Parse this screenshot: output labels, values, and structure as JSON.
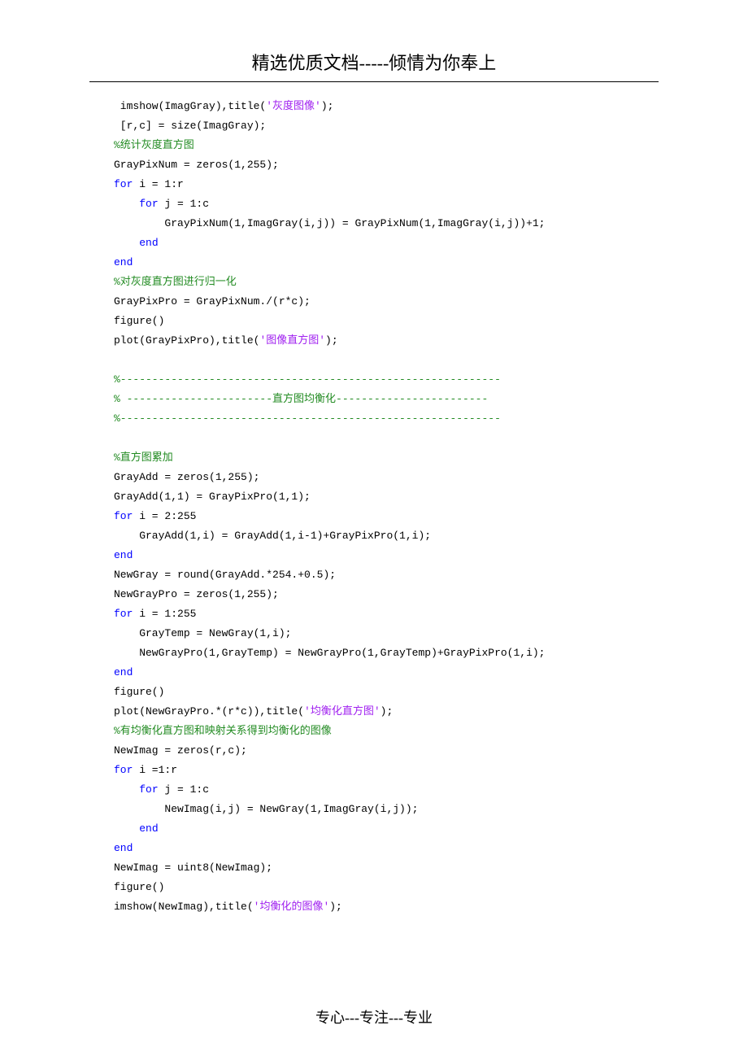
{
  "header": "精选优质文档-----倾情为你奉上",
  "footer": "专心---专注---专业",
  "lines": [
    [
      [
        " imshow(ImagGray),title("
      ],
      [
        "'灰度图像'",
        "purple"
      ],
      [
        ");"
      ]
    ],
    [
      [
        " [r,c] = size(ImagGray);"
      ]
    ],
    [
      [
        "%统计灰度直方图",
        "green"
      ]
    ],
    [
      [
        "GrayPixNum = zeros(1,255);"
      ]
    ],
    [
      [
        "for",
        "blue"
      ],
      [
        " i = 1:r"
      ]
    ],
    [
      [
        "    "
      ],
      [
        "for",
        "blue"
      ],
      [
        " j = 1:c"
      ]
    ],
    [
      [
        "        GrayPixNum(1,ImagGray(i,j)) = GrayPixNum(1,ImagGray(i,j))+1;"
      ]
    ],
    [
      [
        "    "
      ],
      [
        "end",
        "blue"
      ]
    ],
    [
      [
        "end",
        "blue"
      ]
    ],
    [
      [
        "%对灰度直方图进行归一化",
        "green"
      ]
    ],
    [
      [
        "GrayPixPro = GrayPixNum./(r*c);"
      ]
    ],
    [
      [
        "figure()"
      ]
    ],
    [
      [
        "plot(GrayPixPro),title("
      ],
      [
        "'图像直方图'",
        "purple"
      ],
      [
        ");"
      ]
    ],
    [
      [
        " "
      ]
    ],
    [
      [
        "%------------------------------------------------------------",
        "green"
      ]
    ],
    [
      [
        "% -----------------------直方图均衡化------------------------",
        "green"
      ]
    ],
    [
      [
        "%------------------------------------------------------------",
        "green"
      ]
    ],
    [
      [
        " "
      ]
    ],
    [
      [
        "%直方图累加",
        "green"
      ]
    ],
    [
      [
        "GrayAdd = zeros(1,255);"
      ]
    ],
    [
      [
        "GrayAdd(1,1) = GrayPixPro(1,1);"
      ]
    ],
    [
      [
        "for",
        "blue"
      ],
      [
        " i = 2:255"
      ]
    ],
    [
      [
        "    GrayAdd(1,i) = GrayAdd(1,i-1)+GrayPixPro(1,i);"
      ]
    ],
    [
      [
        "end",
        "blue"
      ]
    ],
    [
      [
        "NewGray = round(GrayAdd.*254.+0.5);"
      ]
    ],
    [
      [
        "NewGrayPro = zeros(1,255);"
      ]
    ],
    [
      [
        "for",
        "blue"
      ],
      [
        " i = 1:255"
      ]
    ],
    [
      [
        "    GrayTemp = NewGray(1,i);"
      ]
    ],
    [
      [
        "    NewGrayPro(1,GrayTemp) = NewGrayPro(1,GrayTemp)+GrayPixPro(1,i);"
      ]
    ],
    [
      [
        "end",
        "blue"
      ]
    ],
    [
      [
        "figure()"
      ]
    ],
    [
      [
        "plot(NewGrayPro.*(r*c)),title("
      ],
      [
        "'均衡化直方图'",
        "purple"
      ],
      [
        ");"
      ]
    ],
    [
      [
        "%有均衡化直方图和映射关系得到均衡化的图像",
        "green"
      ]
    ],
    [
      [
        "NewImag = zeros(r,c);"
      ]
    ],
    [
      [
        "for",
        "blue"
      ],
      [
        " i =1:r"
      ]
    ],
    [
      [
        "    "
      ],
      [
        "for",
        "blue"
      ],
      [
        " j = 1:c"
      ]
    ],
    [
      [
        "        NewImag(i,j) = NewGray(1,ImagGray(i,j));"
      ]
    ],
    [
      [
        "    "
      ],
      [
        "end",
        "blue"
      ]
    ],
    [
      [
        "end",
        "blue"
      ]
    ],
    [
      [
        "NewImag = uint8(NewImag);"
      ]
    ],
    [
      [
        "figure()"
      ]
    ],
    [
      [
        "imshow(NewImag),title("
      ],
      [
        "'均衡化的图像'",
        "purple"
      ],
      [
        ");"
      ]
    ]
  ]
}
